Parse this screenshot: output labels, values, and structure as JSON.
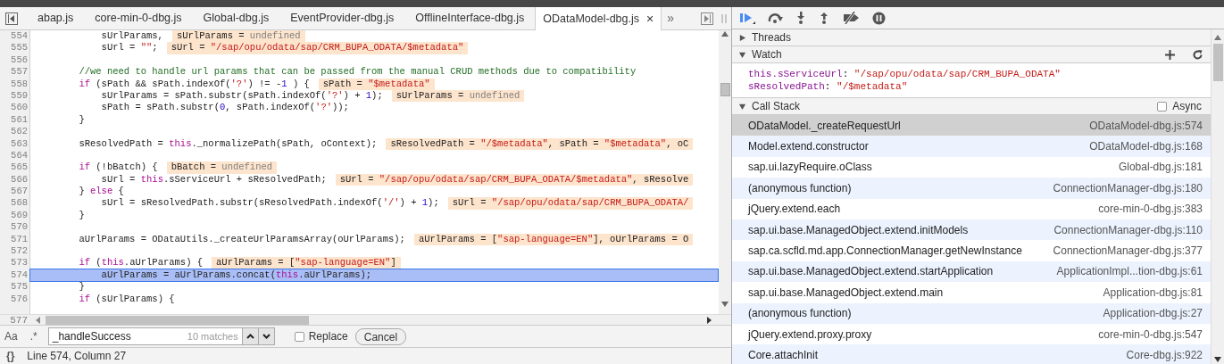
{
  "tabs": [
    {
      "label": "abap.js",
      "selected": false
    },
    {
      "label": "core-min-0-dbg.js",
      "selected": false
    },
    {
      "label": "Global-dbg.js",
      "selected": false
    },
    {
      "label": "EventProvider-dbg.js",
      "selected": false
    },
    {
      "label": "OfflineInterface-dbg.js",
      "selected": false
    },
    {
      "label": "ODataModel-dbg.js",
      "selected": true,
      "close": "×"
    }
  ],
  "tabs_overflow": "»",
  "code": [
    {
      "number": "554",
      "selected": false,
      "tokens": [
        {
          "kind": "plain",
          "text": "            sUrlParams,"
        }
      ],
      "values": [
        {
          "kind": "plain",
          "text": "sUrlParams = "
        },
        {
          "kind": "undefined",
          "text": "undefined"
        }
      ]
    },
    {
      "number": "555",
      "selected": false,
      "tokens": [
        {
          "kind": "plain",
          "text": "            sUrl = "
        },
        {
          "kind": "string",
          "text": "\"\""
        },
        {
          "kind": "plain",
          "text": ";"
        }
      ],
      "values": [
        {
          "kind": "plain",
          "text": "sUrl = "
        },
        {
          "kind": "string",
          "text": "\"/sap/opu/odata/sap/CRM_BUPA_ODATA/$metadata\""
        }
      ]
    },
    {
      "number": "556",
      "selected": false
    },
    {
      "number": "557",
      "selected": false,
      "tokens": [
        {
          "kind": "comment",
          "text": "        //we need to handle url params that can be passed from the manual CRUD methods due to compatibility"
        }
      ]
    },
    {
      "number": "558",
      "selected": false,
      "tokens": [
        {
          "kind": "keyword",
          "text": "        if"
        },
        {
          "kind": "plain",
          "text": " (sPath && sPath.indexOf("
        },
        {
          "kind": "string",
          "text": "'?'"
        },
        {
          "kind": "plain",
          "text": ") != -"
        },
        {
          "kind": "number",
          "text": "1"
        },
        {
          "kind": "plain",
          "text": " ) {"
        }
      ],
      "values": [
        {
          "kind": "plain",
          "text": "sPath = "
        },
        {
          "kind": "string",
          "text": "\"$metadata\""
        }
      ]
    },
    {
      "number": "559",
      "selected": false,
      "tokens": [
        {
          "kind": "plain",
          "text": "            sUrlParams = sPath.substr(sPath.indexOf("
        },
        {
          "kind": "string",
          "text": "'?'"
        },
        {
          "kind": "plain",
          "text": ") + "
        },
        {
          "kind": "number",
          "text": "1"
        },
        {
          "kind": "plain",
          "text": ");"
        }
      ],
      "values": [
        {
          "kind": "plain",
          "text": "sUrlParams = "
        },
        {
          "kind": "undefined",
          "text": "undefined"
        }
      ]
    },
    {
      "number": "560",
      "selected": false,
      "tokens": [
        {
          "kind": "plain",
          "text": "            sPath = sPath.substr("
        },
        {
          "kind": "number",
          "text": "0"
        },
        {
          "kind": "plain",
          "text": ", sPath.indexOf("
        },
        {
          "kind": "string",
          "text": "'?'"
        },
        {
          "kind": "plain",
          "text": "));"
        }
      ]
    },
    {
      "number": "561",
      "selected": false,
      "tokens": [
        {
          "kind": "plain",
          "text": "        }"
        }
      ]
    },
    {
      "number": "562",
      "selected": false
    },
    {
      "number": "563",
      "selected": false,
      "tokens": [
        {
          "kind": "plain",
          "text": "        sResolvedPath = "
        },
        {
          "kind": "keyword",
          "text": "this"
        },
        {
          "kind": "plain",
          "text": "._normalizePath(sPath, oContext);"
        }
      ],
      "values": [
        {
          "kind": "plain",
          "text": "sResolvedPath = "
        },
        {
          "kind": "string",
          "text": "\"/$metadata\""
        },
        {
          "kind": "plain",
          "text": ", sPath = "
        },
        {
          "kind": "string",
          "text": "\"$metadata\""
        },
        {
          "kind": "plain",
          "text": ", oC"
        }
      ]
    },
    {
      "number": "564",
      "selected": false
    },
    {
      "number": "565",
      "selected": false,
      "tokens": [
        {
          "kind": "keyword",
          "text": "        if"
        },
        {
          "kind": "plain",
          "text": " (!bBatch) {"
        }
      ],
      "values": [
        {
          "kind": "plain",
          "text": "bBatch = "
        },
        {
          "kind": "undefined",
          "text": "undefined"
        }
      ]
    },
    {
      "number": "566",
      "selected": false,
      "tokens": [
        {
          "kind": "plain",
          "text": "            sUrl = "
        },
        {
          "kind": "keyword",
          "text": "this"
        },
        {
          "kind": "plain",
          "text": ".sServiceUrl + sResolvedPath;"
        }
      ],
      "values": [
        {
          "kind": "plain",
          "text": "sUrl = "
        },
        {
          "kind": "string",
          "text": "\"/sap/opu/odata/sap/CRM_BUPA_ODATA/$metadata\""
        },
        {
          "kind": "plain",
          "text": ", sResolve"
        }
      ]
    },
    {
      "number": "567",
      "selected": false,
      "tokens": [
        {
          "kind": "plain",
          "text": "        } "
        },
        {
          "kind": "keyword",
          "text": "else"
        },
        {
          "kind": "plain",
          "text": " {"
        }
      ]
    },
    {
      "number": "568",
      "selected": false,
      "tokens": [
        {
          "kind": "plain",
          "text": "            sUrl = sResolvedPath.substr(sResolvedPath.indexOf("
        },
        {
          "kind": "string",
          "text": "'/'"
        },
        {
          "kind": "plain",
          "text": ") + "
        },
        {
          "kind": "number",
          "text": "1"
        },
        {
          "kind": "plain",
          "text": ");"
        }
      ],
      "values": [
        {
          "kind": "plain",
          "text": "sUrl = "
        },
        {
          "kind": "string",
          "text": "\"/sap/opu/odata/sap/CRM_BUPA_ODATA/"
        }
      ]
    },
    {
      "number": "569",
      "selected": false,
      "tokens": [
        {
          "kind": "plain",
          "text": "        }"
        }
      ]
    },
    {
      "number": "570",
      "selected": false
    },
    {
      "number": "571",
      "selected": false,
      "tokens": [
        {
          "kind": "plain",
          "text": "        aUrlParams = ODataUtils._createUrlParamsArray(oUrlParams);"
        }
      ],
      "values": [
        {
          "kind": "plain",
          "text": "aUrlParams = ["
        },
        {
          "kind": "string",
          "text": "\"sap-language=EN\""
        },
        {
          "kind": "plain",
          "text": "], oUrlParams = O"
        }
      ]
    },
    {
      "number": "572",
      "selected": false
    },
    {
      "number": "573",
      "selected": false,
      "tokens": [
        {
          "kind": "keyword",
          "text": "        if"
        },
        {
          "kind": "plain",
          "text": " ("
        },
        {
          "kind": "keyword",
          "text": "this"
        },
        {
          "kind": "plain",
          "text": ".aUrlParams) {"
        }
      ],
      "values": [
        {
          "kind": "plain",
          "text": "aUrlParams = ["
        },
        {
          "kind": "string",
          "text": "\"sap-language=EN\""
        },
        {
          "kind": "plain",
          "text": "]"
        }
      ]
    },
    {
      "number": "574",
      "selected": true,
      "tokens": [
        {
          "kind": "plain",
          "text": "            aUrlParams = aUrlParams.concat("
        },
        {
          "kind": "keyword",
          "text": "this"
        },
        {
          "kind": "plain",
          "text": ".aUrlParams);"
        }
      ]
    },
    {
      "number": "575",
      "selected": false,
      "tokens": [
        {
          "kind": "plain",
          "text": "        }"
        }
      ]
    },
    {
      "number": "576",
      "selected": false,
      "tokens": [
        {
          "kind": "keyword",
          "text": "        if"
        },
        {
          "kind": "plain",
          "text": " (sUrlParams) {"
        }
      ]
    }
  ],
  "last_line_number": "577",
  "search": {
    "case_toggle": "Aa",
    "regex_toggle": ".*",
    "value": "_handleSuccess",
    "matches": "10 matches",
    "replace": {
      "label": "Replace",
      "checked": false
    },
    "cancel": "Cancel"
  },
  "status_bar": {
    "format_toggle": "{}",
    "position": "Line 574, Column 27"
  },
  "sections": [
    {
      "kind": "threads",
      "title": "Threads",
      "expanded": false
    },
    {
      "kind": "watch",
      "title": "Watch",
      "expanded": true,
      "expressions": [
        {
          "name": "this.sServiceUrl",
          "separator": ":",
          "value": "\"/sap/opu/odata/sap/CRM_BUPA_ODATA\""
        },
        {
          "name": "sResolvedPath",
          "separator": ":",
          "value": "\"/$metadata\""
        }
      ]
    },
    {
      "kind": "callstack",
      "title": "Call Stack",
      "expanded": true,
      "async": {
        "label": "Async",
        "checked": false
      },
      "frames": [
        {
          "name": "ODataModel._createRequestUrl",
          "location": "ODataModel-dbg.js:574",
          "selected": true
        },
        {
          "name": "Model.extend.constructor",
          "location": "ODataModel-dbg.js:168",
          "selected": false
        },
        {
          "name": "sap.ui.lazyRequire.oClass",
          "location": "Global-dbg.js:181",
          "selected": false
        },
        {
          "name": "(anonymous function)",
          "location": "ConnectionManager-dbg.js:180",
          "selected": false
        },
        {
          "name": "jQuery.extend.each",
          "location": "core-min-0-dbg.js:383",
          "selected": false
        },
        {
          "name": "sap.ui.base.ManagedObject.extend.initModels",
          "location": "ConnectionManager-dbg.js:110",
          "selected": false
        },
        {
          "name": "sap.ca.scfld.md.app.ConnectionManager.getNewInstance",
          "location": "ConnectionManager-dbg.js:377",
          "selected": false
        },
        {
          "name": "sap.ui.base.ManagedObject.extend.startApplication",
          "location": "ApplicationImpl...tion-dbg.js:61",
          "selected": false
        },
        {
          "name": "sap.ui.base.ManagedObject.extend.main",
          "location": "Application-dbg.js:81",
          "selected": false
        },
        {
          "name": "(anonymous function)",
          "location": "Application-dbg.js:27",
          "selected": false
        },
        {
          "name": "jQuery.extend.proxy.proxy",
          "location": "core-min-0-dbg.js:547",
          "selected": false
        },
        {
          "name": "Core.attachInit",
          "location": "Core-dbg.js:922",
          "selected": false
        }
      ]
    }
  ]
}
